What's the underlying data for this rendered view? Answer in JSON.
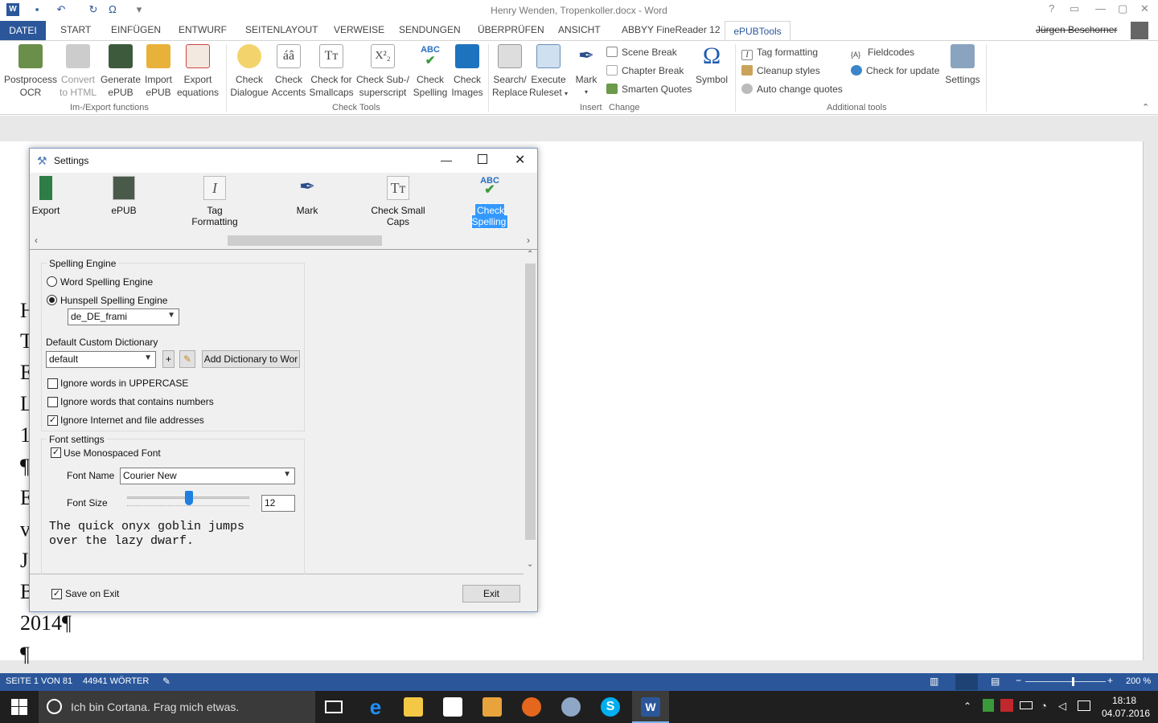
{
  "window": {
    "title": "Henry Wenden, Tropenkoller.docx - Word",
    "help_label": "?",
    "user_name": "Jürgen Beschorner"
  },
  "tabs": [
    "DATEI",
    "START",
    "EINFÜGEN",
    "ENTWURF",
    "SEITENLAYOUT",
    "VERWEISE",
    "SENDUNGEN",
    "ÜBERPRÜFEN",
    "ANSICHT",
    "ABBYY FineReader 12",
    "ePUBTools"
  ],
  "ribbon": {
    "groups": {
      "imexport": "Im-/Export functions",
      "checktools": "Check Tools",
      "insert": "Insert",
      "change": "Change",
      "additional": "Additional tools"
    },
    "buttons": {
      "postprocess": [
        "Postprocess",
        "OCR"
      ],
      "convert": [
        "Convert",
        "to HTML"
      ],
      "generate": [
        "Generate",
        "ePUB"
      ],
      "import": [
        "Import",
        "ePUB"
      ],
      "export": [
        "Export",
        "equations"
      ],
      "check_dialogue": [
        "Check",
        "Dialogue"
      ],
      "check_accents": [
        "Check",
        "Accents"
      ],
      "check_smallcaps": [
        "Check for",
        "Smallcaps"
      ],
      "check_sub": [
        "Check Sub-/",
        "superscript"
      ],
      "check_spelling": [
        "Check",
        "Spelling"
      ],
      "check_images": [
        "Check",
        "Images"
      ],
      "search_replace": [
        "Search/",
        "Replace"
      ],
      "execute_ruleset": [
        "Execute",
        "Ruleset"
      ],
      "mark": [
        "Mark",
        ""
      ],
      "symbol": [
        "Symbol",
        ""
      ],
      "settings": [
        "Settings",
        ""
      ]
    },
    "insert_items": [
      "Scene Break",
      "Chapter Break",
      "Smarten Quotes"
    ],
    "additional_items": [
      "Tag formatting",
      "Cleanup styles",
      "Auto change quotes",
      "Fieldcodes",
      "Check for update"
    ],
    "icon_glyphs": {
      "accents": "áâ",
      "smallcaps": "Tт",
      "sub": "X²₂",
      "spelling_abc": "ABC",
      "symbol": "Ω",
      "fieldcodes": "{A}"
    }
  },
  "document": {
    "lines": [
      "H",
      "T",
      "E",
      "L",
      "1",
      "¶",
      "E",
      "v",
      "J",
      "B",
      "2014¶",
      "¶"
    ]
  },
  "status": {
    "page": "SEITE 1 VON 81",
    "words": "44941 WÖRTER",
    "zoom": "200 %"
  },
  "taskbar": {
    "search_placeholder": "Ich bin Cortana. Frag mich etwas.",
    "time": "18:18",
    "date": "04.07.2016"
  },
  "dialog": {
    "title": "Settings",
    "pages": [
      "Export",
      "ePUB",
      "Tag Formatting",
      "Mark",
      "Check Small Caps",
      "Check Spelling"
    ],
    "spelling_engine": {
      "title": "Spelling Engine",
      "word_option": "Word Spelling Engine",
      "hunspell_option": "Hunspell Spelling Engine",
      "selected": "hunspell",
      "language": "de_DE_frami"
    },
    "custom_dict": {
      "label": "Default Custom Dictionary",
      "value": "default",
      "add_button": "Add Dictionary to Wor",
      "plus_label": "+"
    },
    "options": [
      {
        "label": "Ignore words in UPPERCASE",
        "checked": false
      },
      {
        "label": "Ignore words that contains numbers",
        "checked": false
      },
      {
        "label": "Ignore Internet and file addresses",
        "checked": true
      }
    ],
    "font_settings": {
      "title": "Font settings",
      "monospace_label": "Use Monospaced Font",
      "monospace_checked": true,
      "font_name_label": "Font Name",
      "font_name": "Courier New",
      "font_size_label": "Font Size",
      "font_size": "12",
      "preview": "The quick onyx goblin jumps\nover the lazy dwarf."
    },
    "save_on_exit_label": "Save on Exit",
    "save_on_exit_checked": true,
    "exit_button": "Exit"
  },
  "colors": {
    "word_blue": "#2b579a",
    "selection": "#3399ff"
  }
}
